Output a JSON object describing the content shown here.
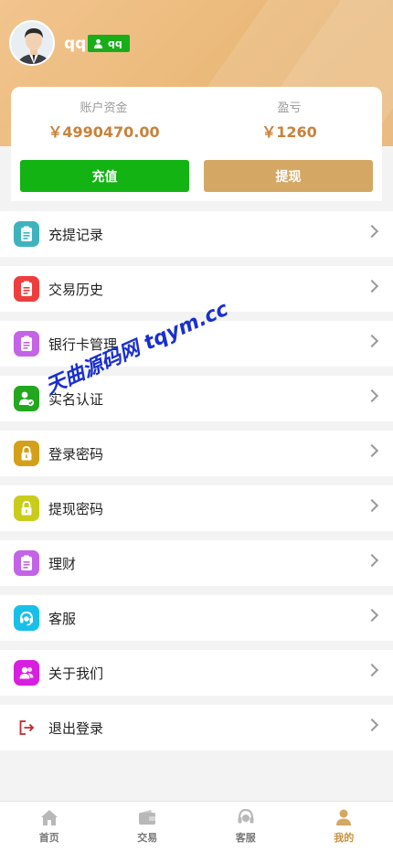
{
  "user": {
    "name": "qq",
    "badge": "qq"
  },
  "funds": {
    "balance_label": "账户资金",
    "balance_value": "￥4990470.00",
    "profit_label": "盈亏",
    "profit_value": "￥1260"
  },
  "actions": {
    "recharge": "充值",
    "withdraw": "提现"
  },
  "menu": [
    {
      "label": "充提记录",
      "icon": "records-icon",
      "color": "#3fb3bd"
    },
    {
      "label": "交易历史",
      "icon": "history-icon",
      "color": "#ef3d3d"
    },
    {
      "label": "银行卡管理",
      "icon": "bank-card-icon",
      "color": "#c364e8"
    },
    {
      "label": "实名认证",
      "icon": "verify-user-icon",
      "color": "#22a71f"
    },
    {
      "label": "登录密码",
      "icon": "login-lock-icon",
      "color": "#d4a01a"
    },
    {
      "label": "提现密码",
      "icon": "withdraw-lock-icon",
      "color": "#c9cc1a"
    },
    {
      "label": "理财",
      "icon": "finance-icon",
      "color": "#c364e8"
    },
    {
      "label": "客服",
      "icon": "headset-icon",
      "color": "#18c0e8"
    },
    {
      "label": "关于我们",
      "icon": "users-icon",
      "color": "#d81fe0"
    },
    {
      "label": "退出登录",
      "icon": "logout-icon",
      "color": "#ffffff"
    }
  ],
  "watermark": "天曲源码网 tqym.cc",
  "tabs": [
    {
      "label": "首页",
      "icon": "home-icon"
    },
    {
      "label": "交易",
      "icon": "wallet-icon"
    },
    {
      "label": "客服",
      "icon": "service-icon"
    },
    {
      "label": "我的",
      "icon": "profile-icon"
    }
  ],
  "colors": {
    "accent": "#c9913f",
    "green": "#12b312",
    "header": "#eab979"
  }
}
